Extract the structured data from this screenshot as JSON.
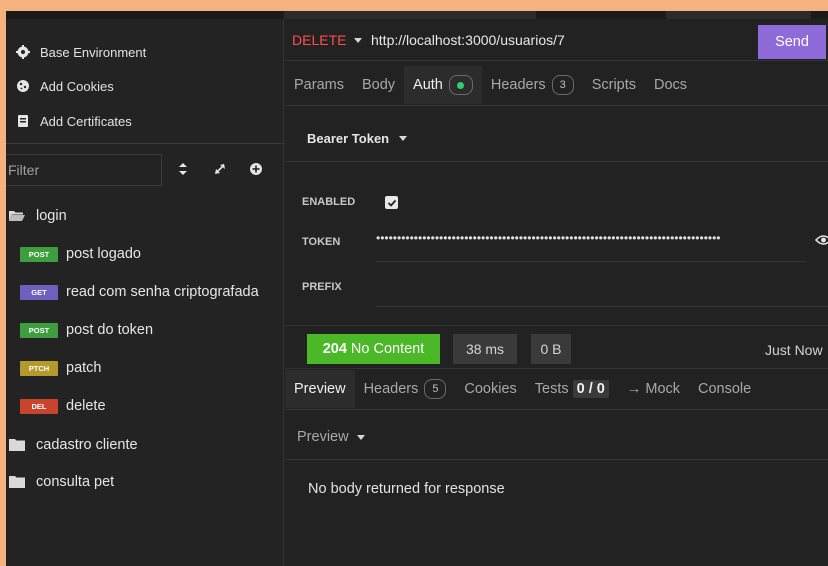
{
  "sidebar": {
    "environment_items": [
      {
        "label": "Base Environment",
        "icon": "gear-icon"
      },
      {
        "label": "Add Cookies",
        "icon": "cookie-icon"
      },
      {
        "label": "Add Certificates",
        "icon": "certificate-icon"
      }
    ],
    "filter": {
      "placeholder": "Filter"
    },
    "tree": [
      {
        "type": "folder",
        "label": "login",
        "open": true
      },
      {
        "type": "request",
        "method": "POST",
        "label": "post logado",
        "color": "#3e9d3c"
      },
      {
        "type": "request",
        "method": "GET",
        "label": "read com senha criptografada",
        "color": "#6f5fbf"
      },
      {
        "type": "request",
        "method": "POST",
        "label": "post do token",
        "color": "#3e9d3c"
      },
      {
        "type": "request",
        "method": "PTCH",
        "label": "patch",
        "color": "#b49a2a"
      },
      {
        "type": "request",
        "method": "DEL",
        "label": "delete",
        "color": "#c9442f"
      },
      {
        "type": "folder",
        "label": "cadastro cliente",
        "open": false
      },
      {
        "type": "folder",
        "label": "consulta pet",
        "open": false
      }
    ]
  },
  "request": {
    "method": "DELETE",
    "method_color": "#ff4d4d",
    "url": "http://localhost:3000/usuarios/7",
    "send_label": "Send",
    "send_color": "#8e6bd9",
    "tabs": [
      {
        "label": "Params"
      },
      {
        "label": "Body"
      },
      {
        "label": "Auth",
        "active": true,
        "dot": true
      },
      {
        "label": "Headers",
        "count": "3"
      },
      {
        "label": "Scripts"
      },
      {
        "label": "Docs"
      }
    ],
    "auth": {
      "type_label": "Bearer Token",
      "enabled_label": "ENABLED",
      "enabled": true,
      "token_label": "TOKEN",
      "token_masked": "••••••••••••••••••••••••••••••••••••••••••••••••••••••••••••••••••••••••••••••••••",
      "prefix_label": "PREFIX"
    }
  },
  "response": {
    "status_code": "204",
    "status_text": "No Content",
    "status_color": "#4ab827",
    "time": "38 ms",
    "size": "0 B",
    "timestamp": "Just Now",
    "tabs": [
      {
        "label": "Preview",
        "active": true
      },
      {
        "label": "Headers",
        "count": "5"
      },
      {
        "label": "Cookies"
      },
      {
        "label": "Tests",
        "value": "0 / 0"
      },
      {
        "label": "→ Mock"
      },
      {
        "label": "Console"
      }
    ],
    "preview_mode": "Preview",
    "body_message": "No body returned for response"
  }
}
